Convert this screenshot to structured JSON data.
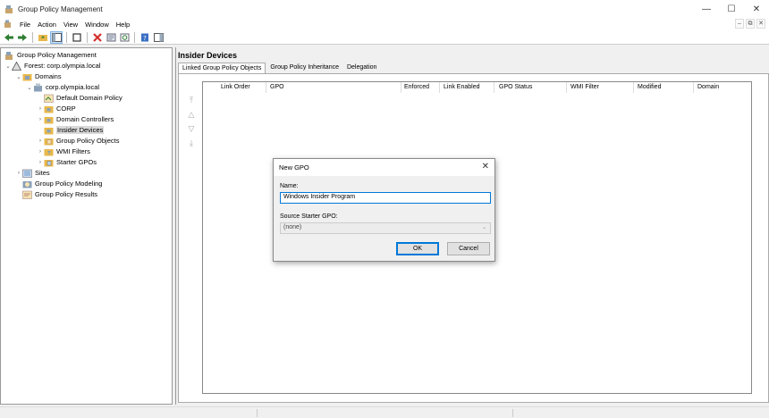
{
  "window": {
    "title": "Group Policy Management",
    "controls": [
      "—",
      "☐",
      "✕"
    ]
  },
  "menu": {
    "items": [
      "File",
      "Action",
      "View",
      "Window",
      "Help"
    ],
    "mdi_controls": [
      "–",
      "⧉",
      "✕"
    ]
  },
  "tree": {
    "root": "Group Policy Management",
    "forest": "Forest: corp.olympia.local",
    "domains": "Domains",
    "domain": "corp.olympia.local",
    "default_policy": "Default Domain Policy",
    "corp": "CORP",
    "domain_controllers": "Domain Controllers",
    "insider_devices": "Insider Devices",
    "gpo_objects": "Group Policy Objects",
    "wmi_filters": "WMI Filters",
    "starter_gpos": "Starter GPOs",
    "sites": "Sites",
    "modeling": "Group Policy Modeling",
    "results": "Group Policy Results"
  },
  "content": {
    "title": "Insider Devices",
    "tabs": [
      "Linked Group Policy Objects",
      "Group Policy Inheritance",
      "Delegation"
    ],
    "columns": [
      "Link Order",
      "GPO",
      "Enforced",
      "Link Enabled",
      "GPO Status",
      "WMI Filter",
      "Modified",
      "Domain"
    ]
  },
  "dialog": {
    "title": "New GPO",
    "name_label": "Name:",
    "name_value": "Windows Insider Program",
    "starter_label": "Source Starter GPO:",
    "starter_value": "(none)",
    "ok_label": "OK",
    "cancel_label": "Cancel"
  },
  "colors": {
    "accent": "#0078d7",
    "folder": "#e8b84a",
    "delete_red": "#d32f2f",
    "help_blue": "#3a6fc4"
  }
}
